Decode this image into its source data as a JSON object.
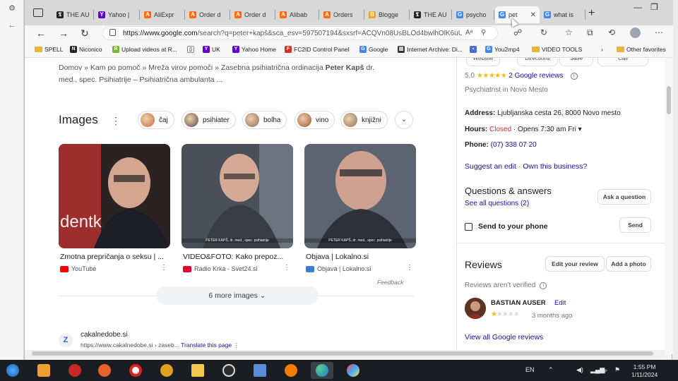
{
  "browser": {
    "tabs": [
      {
        "label": "THE AU",
        "fav_color": "#222222",
        "fav_glyph": "𝕿"
      },
      {
        "label": "Yahoo |",
        "fav_color": "#6001d2",
        "fav_glyph": "Y"
      },
      {
        "label": "AliExpr",
        "fav_color": "#ff6a00",
        "fav_glyph": "A"
      },
      {
        "label": "Order d",
        "fav_color": "#ff6a00",
        "fav_glyph": "A"
      },
      {
        "label": "Order d",
        "fav_color": "#ff6a00",
        "fav_glyph": "A"
      },
      {
        "label": "Alibab",
        "fav_color": "#ff6a00",
        "fav_glyph": "A"
      },
      {
        "label": "Orders",
        "fav_color": "#ff6a00",
        "fav_glyph": "A"
      },
      {
        "label": "Blogge",
        "fav_color": "#f4a21c",
        "fav_glyph": "B"
      },
      {
        "label": "THE AU",
        "fav_color": "#222222",
        "fav_glyph": "𝕿"
      },
      {
        "label": "psycho",
        "fav_color": "#4285f4",
        "fav_glyph": "G"
      },
      {
        "label": "pet",
        "fav_color": "#4285f4",
        "fav_glyph": "G",
        "active": true
      },
      {
        "label": "what is",
        "fav_color": "#4285f4",
        "fav_glyph": "G"
      }
    ],
    "address": {
      "host": "https://www.google.com",
      "rest": "/search?q=peter+kapš&sca_esv=597507194&sxsrf=ACQVn08UsBLOd4bwlhOlK6uU_jVE0..."
    },
    "bookmarks": [
      {
        "label": "SPELL",
        "type": "folder"
      },
      {
        "label": "Niconico",
        "fav_color": "#222222",
        "fav_glyph": "N"
      },
      {
        "label": "Upload videos at R...",
        "fav_color": "#77b82a",
        "fav_glyph": "R"
      },
      {
        "label": "",
        "fav_color": "#ffffff",
        "fav_glyph": "▯"
      },
      {
        "label": "UK",
        "fav_color": "#6001d2",
        "fav_glyph": "Y"
      },
      {
        "label": "Yahoo Home",
        "fav_color": "#6001d2",
        "fav_glyph": "Y"
      },
      {
        "label": "FC2ID Control Panel",
        "fav_color": "#d93025",
        "fav_glyph": "F"
      },
      {
        "label": "Google",
        "fav_color": "#4285f4",
        "fav_glyph": "G"
      },
      {
        "label": "Internet Archive: Di...",
        "fav_color": "#333333",
        "fav_glyph": "▥"
      },
      {
        "label": "",
        "fav_color": "#4a6fd1",
        "fav_glyph": "▪"
      },
      {
        "label": "You2mp4",
        "fav_color": "#4285f4",
        "fav_glyph": "G"
      },
      {
        "label": "VIDEO TOOLS",
        "type": "folder"
      },
      {
        "label": "Other favorites",
        "type": "folder"
      }
    ]
  },
  "search": {
    "snippet_plain": "Domov » Kam po pomoč » Mreža virov pomoči » Zasebna psihiatrična ordinacija ",
    "snippet_bold": "Peter Kapš",
    "snippet_tail": " dr. med., spec. Psihiatrije – Psihiatrična ambulanta ...",
    "images_title": "Images",
    "chips": [
      {
        "label": "čaj",
        "color": "#c46a3a"
      },
      {
        "label": "psihiater",
        "color": "#5b4a42"
      },
      {
        "label": "bolha",
        "color": "#8a6a55"
      },
      {
        "label": "vino",
        "color": "#a0522d"
      },
      {
        "label": "knjižni",
        "color": "#8b7355"
      }
    ],
    "images": [
      {
        "title": "Zmotna prepričanja o seksu | ...",
        "source": "YouTube",
        "source_color": "#ff0000",
        "caption": ""
      },
      {
        "title": "VIDEO&FOTO: Kako prepoz...",
        "source": "Radio Krka - Svet24.si",
        "source_color": "#e4032c",
        "caption": "PETER KAPŠ, dr. med., spec. psihiatrije"
      },
      {
        "title": "Objava | Lokalno.si",
        "source": "Objava | Lokalno.si",
        "source_color": "#3b7dd8",
        "caption": "PETER KAPŠ, dr. med., spec. psihiatrije"
      }
    ],
    "feedback": "Feedback",
    "more_images": "6 more images",
    "result": {
      "favicon": "Z",
      "site": "cakalnedobe.si",
      "url": "https://www.cakalnedobe.si › zaseb...",
      "translate": "Translate this page"
    }
  },
  "panel": {
    "top_buttons": [
      "Website",
      "Directions",
      "Save",
      "Call"
    ],
    "rating": "5,0",
    "stars": "★★★★★",
    "reviews_link": "2 Google reviews",
    "category": "Psychiatrist in Novo Mesto",
    "address_label": "Address:",
    "address_value": "Ljubljanska cesta 26, 8000 Novo mesto",
    "hours_label": "Hours:",
    "hours_status": "Closed",
    "hours_rest": " · Opens 7:30 am Fri ▾",
    "phone_label": "Phone:",
    "phone_value": "(07) 338 07 20",
    "suggest_edit": "Suggest an edit",
    "own_business": "Own this business?",
    "qa_title": "Questions & answers",
    "qa_link": "See all questions (2)",
    "ask_button": "Ask a question",
    "send_label": "Send to your phone",
    "send_button": "Send",
    "reviews_title": "Reviews",
    "edit_review_button": "Edit your review",
    "add_photo_button": "Add a photo",
    "unverified": "Reviews aren't verified",
    "reviewer": "BASTIAN AUSER",
    "reviewer_edit": "Edit",
    "review_rating": 1,
    "review_time": "3 months ago",
    "view_all": "View all Google reviews"
  },
  "taskbar": {
    "lang": "EN",
    "time": "1:55 PM",
    "date": "1/11/2024"
  }
}
